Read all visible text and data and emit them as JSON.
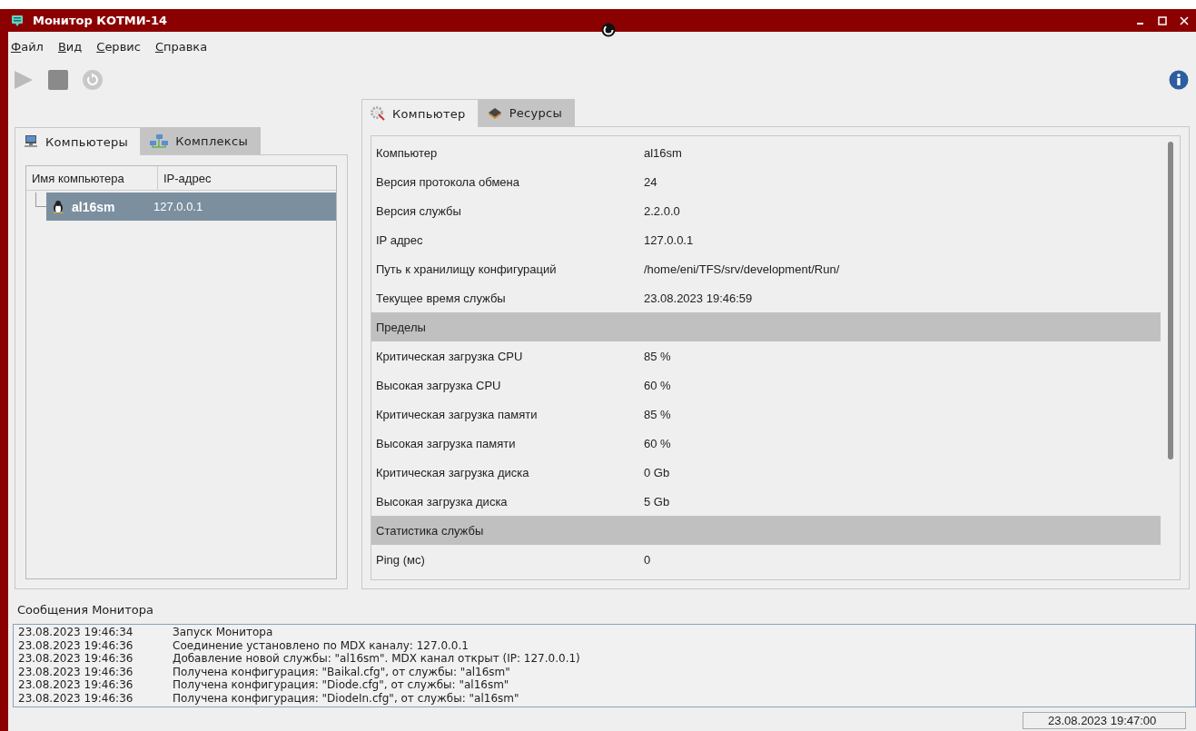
{
  "window": {
    "title": "Монитор КОТМИ-14"
  },
  "menu": [
    "Файл",
    "Вид",
    "Сервис",
    "Справка"
  ],
  "toolbar": [
    {
      "kind": "play",
      "disabled": true
    },
    {
      "kind": "stop",
      "disabled": true
    },
    {
      "kind": "refresh",
      "disabled": true
    }
  ],
  "left_tabs": [
    {
      "label": "Компьютеры",
      "kind": "computer",
      "selected": true
    },
    {
      "label": "Комплексы",
      "kind": "network",
      "selected": false
    }
  ],
  "tree": {
    "columns": [
      "Имя компьютера",
      "IP-адрес"
    ],
    "rows": [
      {
        "name": "al16sm",
        "ip": "127.0.0.1",
        "selected": true
      }
    ]
  },
  "right_tabs": [
    {
      "label": "Компьютер",
      "kind": "gear",
      "selected": true
    },
    {
      "label": "Ресурсы",
      "kind": "chip",
      "selected": false
    }
  ],
  "properties": [
    {
      "kind": "row",
      "label": "Компьютер",
      "value": "al16sm"
    },
    {
      "kind": "row",
      "label": "Версия протокола обмена",
      "value": "24"
    },
    {
      "kind": "row",
      "label": "Версия службы",
      "value": "2.2.0.0"
    },
    {
      "kind": "row",
      "label": "IP адрес",
      "value": "127.0.0.1"
    },
    {
      "kind": "row",
      "label": "Путь к хранилищу конфигураций",
      "value": "/home/eni/TFS/srv/development/Run/"
    },
    {
      "kind": "row",
      "label": "Текущее время службы",
      "value": "23.08.2023 19:46:59"
    },
    {
      "kind": "section",
      "label": "Пределы"
    },
    {
      "kind": "row",
      "label": "Критическая загрузка CPU",
      "value": "85 %"
    },
    {
      "kind": "row",
      "label": "Высокая загрузка CPU",
      "value": "60 %"
    },
    {
      "kind": "row",
      "label": "Критическая загрузка памяти",
      "value": "85 %"
    },
    {
      "kind": "row",
      "label": "Высокая загрузка памяти",
      "value": "60 %"
    },
    {
      "kind": "row",
      "label": "Критическая загрузка диска",
      "value": "0 Gb"
    },
    {
      "kind": "row",
      "label": "Высокая загрузка диска",
      "value": "5 Gb"
    },
    {
      "kind": "section",
      "label": "Статистика службы"
    },
    {
      "kind": "row",
      "label": "Ping (мс)",
      "value": "0"
    }
  ],
  "messages": {
    "title": "Сообщения Монитора",
    "rows": [
      {
        "time": "23.08.2023 19:46:34",
        "text": "Запуск Монитора"
      },
      {
        "time": "23.08.2023 19:46:36",
        "text": "Соединение установлено по MDX каналу: 127.0.0.1"
      },
      {
        "time": "23.08.2023 19:46:36",
        "text": "Добавление новой службы: \"al16sm\". MDX канал открыт (IP: 127.0.0.1)"
      },
      {
        "time": "23.08.2023 19:46:36",
        "text": "Получена конфигурация: \"Baikal.cfg\", от службы: \"al16sm\""
      },
      {
        "time": "23.08.2023 19:46:36",
        "text": "Получена конфигурация: \"Diode.cfg\", от службы: \"al16sm\""
      },
      {
        "time": "23.08.2023 19:46:36",
        "text": "Получена конфигурация: \"DiodeIn.cfg\", от службы: \"al16sm\""
      }
    ]
  },
  "status_bar": {
    "time": "23.08.2023 19:47:00"
  }
}
